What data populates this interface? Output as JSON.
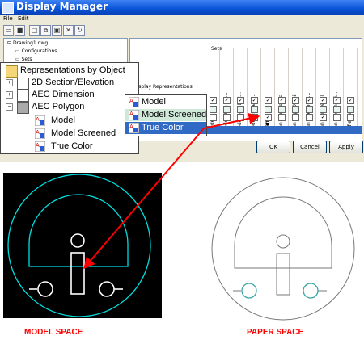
{
  "window": {
    "title": "Display Manager"
  },
  "menu": [
    "File",
    "Edit"
  ],
  "tree": [
    {
      "label": "Drawing1.dwg",
      "indent": 0
    },
    {
      "label": "Configurations",
      "indent": 1
    },
    {
      "label": "Sets",
      "indent": 1
    }
  ],
  "grid": {
    "sets_label": "Sets",
    "row_header": "Display Representations",
    "columns": [
      "Model",
      "Model High De...",
      "Model Low Det...",
      "Model Present...",
      "Plan",
      "Plan Diagnostic",
      "Plan High Detail",
      "Plan Intermedi...",
      "Plan Low Detail",
      "Plan Presentati...",
      "Reflected"
    ]
  },
  "buttons": {
    "ok": "OK",
    "cancel": "Cancel",
    "apply": "Apply"
  },
  "rep_panel": {
    "items": [
      {
        "label": "Representations by Object",
        "level": 0,
        "expander": "",
        "icon": "folder"
      },
      {
        "label": "2D Section/Elevation",
        "level": 1,
        "expander": "+",
        "icon": "object"
      },
      {
        "label": "AEC Dimension",
        "level": 1,
        "expander": "+",
        "icon": "object"
      },
      {
        "label": "AEC Polygon",
        "level": 1,
        "expander": "−",
        "icon": "object"
      },
      {
        "label": "Model",
        "level": 2,
        "expander": "",
        "icon": "rep"
      },
      {
        "label": "Model Screened",
        "level": 2,
        "expander": "",
        "icon": "rep"
      },
      {
        "label": "True Color",
        "level": 2,
        "expander": "",
        "icon": "rep"
      }
    ]
  },
  "sets_panel": {
    "items": [
      {
        "label": "Model",
        "highlight": "none"
      },
      {
        "label": "Model Screened",
        "highlight": "light"
      },
      {
        "label": "True Color",
        "highlight": "selected"
      }
    ]
  },
  "labels": {
    "model_space": "MODEL SPACE",
    "paper_space": "PAPER SPACE"
  },
  "colors": {
    "selection": "#316ac5",
    "light_highlight": "#cfe8d8",
    "arrow": "#ff0000",
    "model_bg": "#000000",
    "cyan": "#00e0e0"
  }
}
